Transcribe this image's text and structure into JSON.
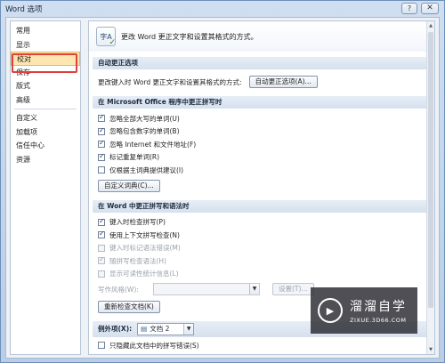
{
  "window": {
    "title": "Word 选项",
    "help": "?",
    "close": "✕"
  },
  "nav": {
    "items": [
      {
        "label": "常用"
      },
      {
        "label": "显示"
      },
      {
        "label": "校对"
      },
      {
        "label": "保存"
      },
      {
        "label": "版式"
      },
      {
        "label": "高级"
      },
      {
        "label": "自定义"
      },
      {
        "label": "加载项"
      },
      {
        "label": "信任中心"
      },
      {
        "label": "资源"
      }
    ],
    "selected": "校对"
  },
  "header": {
    "icon_text": "字A",
    "text": "更改 Word 更正文字和设置其格式的方式。"
  },
  "autocorrect": {
    "section": "自动更正选项",
    "label": "更改键入时 Word 更正文字和设置其格式的方式:",
    "button": "自动更正选项(A)..."
  },
  "office": {
    "section": "在 Microsoft Office 程序中更正拼写时",
    "options": [
      {
        "label": "忽略全部大写的单词(U)",
        "checked": true
      },
      {
        "label": "忽略包含数字的单词(B)",
        "checked": true
      },
      {
        "label": "忽略 Internet 和文件地址(F)",
        "checked": true
      },
      {
        "label": "标记重复单词(R)",
        "checked": true
      },
      {
        "label": "仅根据主词典提供建议(I)",
        "checked": false
      }
    ],
    "button": "自定义词典(C)..."
  },
  "word": {
    "section": "在 Word 中更正拼写和语法时",
    "options": [
      {
        "label": "键入时检查拼写(P)",
        "checked": true,
        "disabled": false
      },
      {
        "label": "使用上下文拼写检查(N)",
        "checked": true,
        "disabled": false
      },
      {
        "label": "键入时标记语法错误(M)",
        "checked": false,
        "disabled": true
      },
      {
        "label": "随拼写检查语法(H)",
        "checked": true,
        "disabled": true
      },
      {
        "label": "显示可读性统计信息(L)",
        "checked": false,
        "disabled": true
      }
    ],
    "style_label": "写作风格(W):",
    "settings_button": "设置(T)...",
    "recheck_button": "重新检查文档(K)"
  },
  "exceptions": {
    "label": "例外项(X):",
    "document": "文档 2",
    "partial": "只隐藏此文档中的拼写错误(S)"
  },
  "watermark": {
    "logo": "▶",
    "name": "溜溜自学",
    "url": "ZIXUE.3D66.COM"
  }
}
